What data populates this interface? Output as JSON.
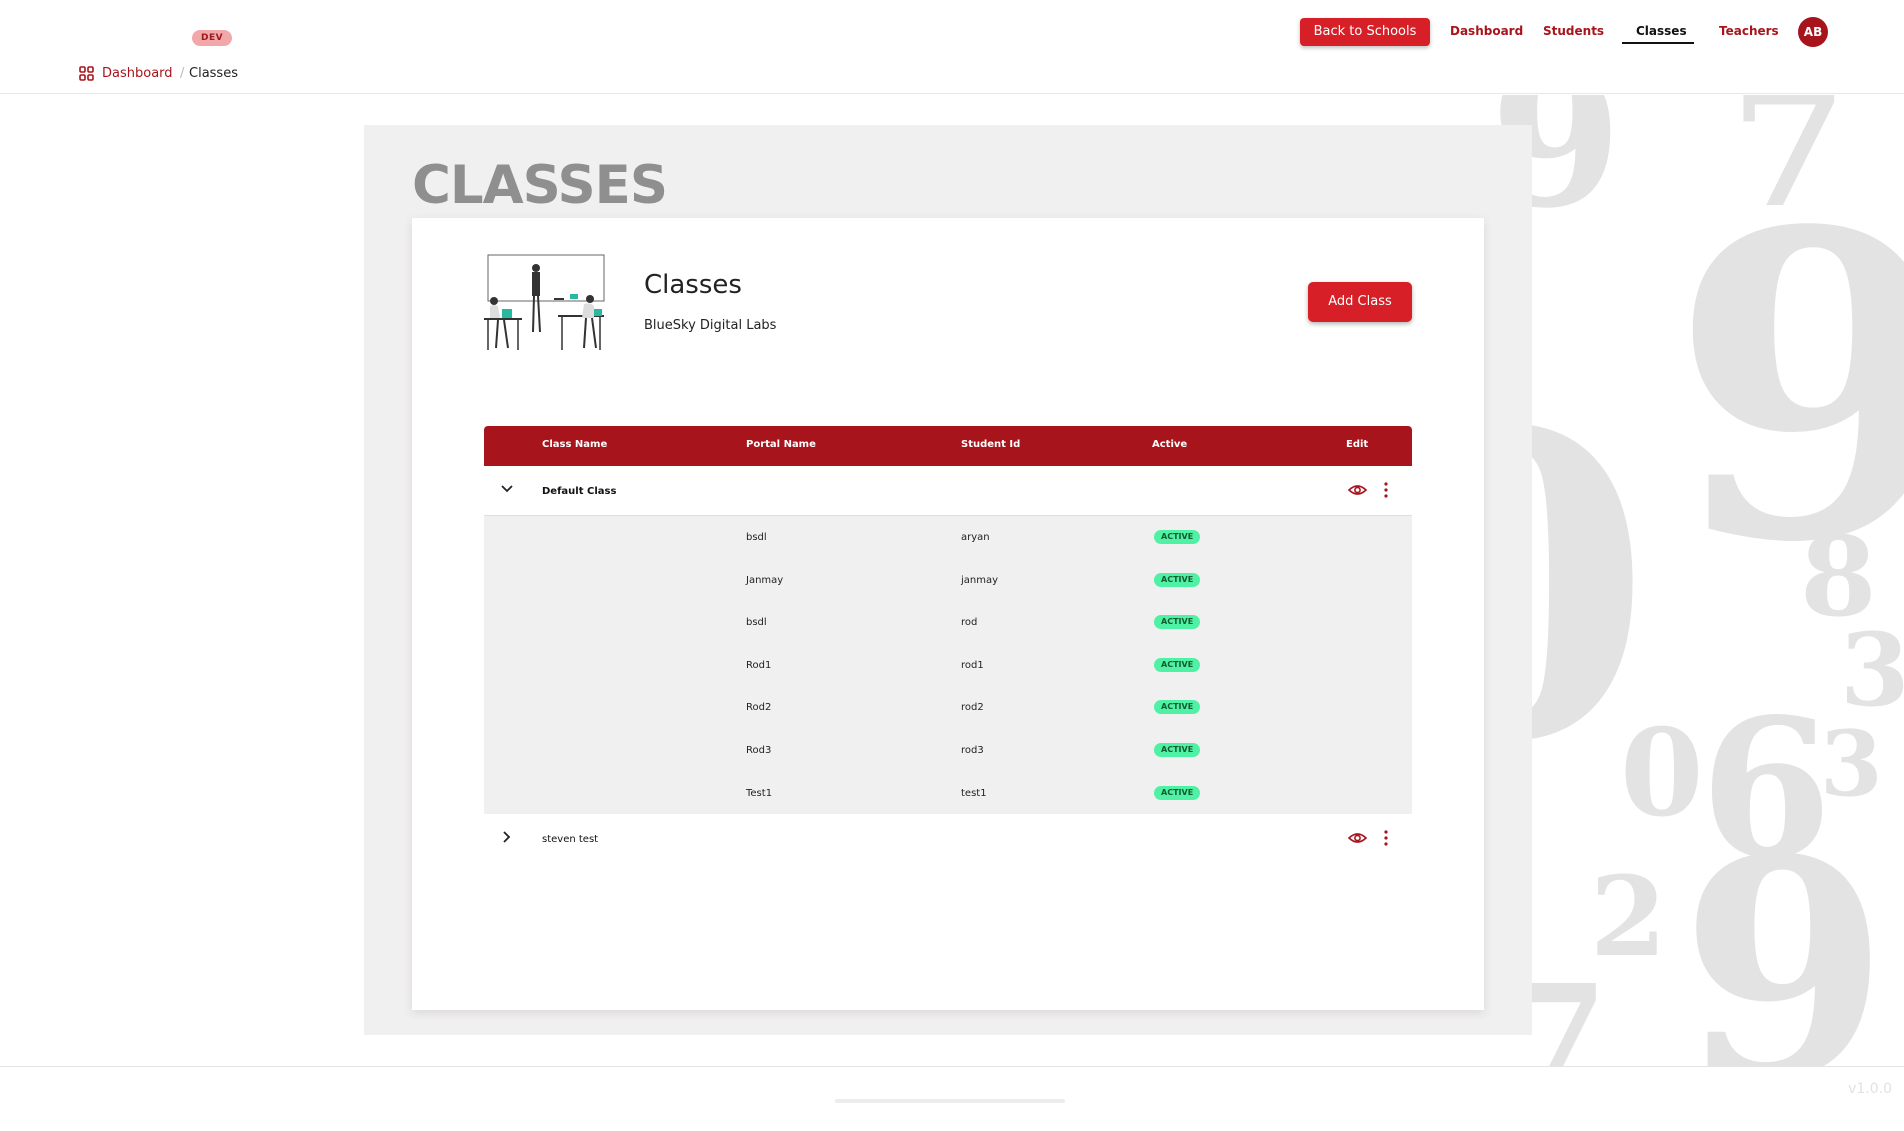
{
  "header": {
    "badge": "DEV",
    "back_button": "Back to Schools",
    "nav": [
      {
        "label": "Dashboard"
      },
      {
        "label": "Students"
      },
      {
        "label": "Classes",
        "active": true
      },
      {
        "label": "Teachers"
      }
    ],
    "avatar_initials": "AB"
  },
  "breadcrumb": {
    "icon": "dashboard-grid-icon",
    "items": [
      "Dashboard",
      "Classes"
    ]
  },
  "page": {
    "heading": "CLASSES",
    "card_title": "Classes",
    "school_name": "BlueSky Digital Labs",
    "add_button": "Add Class"
  },
  "table": {
    "columns": [
      "Class Name",
      "Portal Name",
      "Student Id",
      "Active",
      "Edit"
    ],
    "groups": [
      {
        "name": "Default Class",
        "expanded": true,
        "students": [
          {
            "portal": "bsdl",
            "student_id": "aryan",
            "status": "ACTIVE"
          },
          {
            "portal": "Janmay",
            "student_id": "janmay",
            "status": "ACTIVE"
          },
          {
            "portal": "bsdl",
            "student_id": "rod",
            "status": "ACTIVE"
          },
          {
            "portal": "Rod1",
            "student_id": "rod1",
            "status": "ACTIVE"
          },
          {
            "portal": "Rod2",
            "student_id": "rod2",
            "status": "ACTIVE"
          },
          {
            "portal": "Rod3",
            "student_id": "rod3",
            "status": "ACTIVE"
          },
          {
            "portal": "Test1",
            "student_id": "test1",
            "status": "ACTIVE"
          }
        ]
      },
      {
        "name": "steven test",
        "expanded": false,
        "students": []
      }
    ]
  },
  "footer": {
    "version": "v1.0.0"
  },
  "colors": {
    "brand_red": "#a8141b",
    "button_red": "#d71f27",
    "active_pill": "#4ff2a4",
    "heading_gray": "#8f8f8f"
  }
}
